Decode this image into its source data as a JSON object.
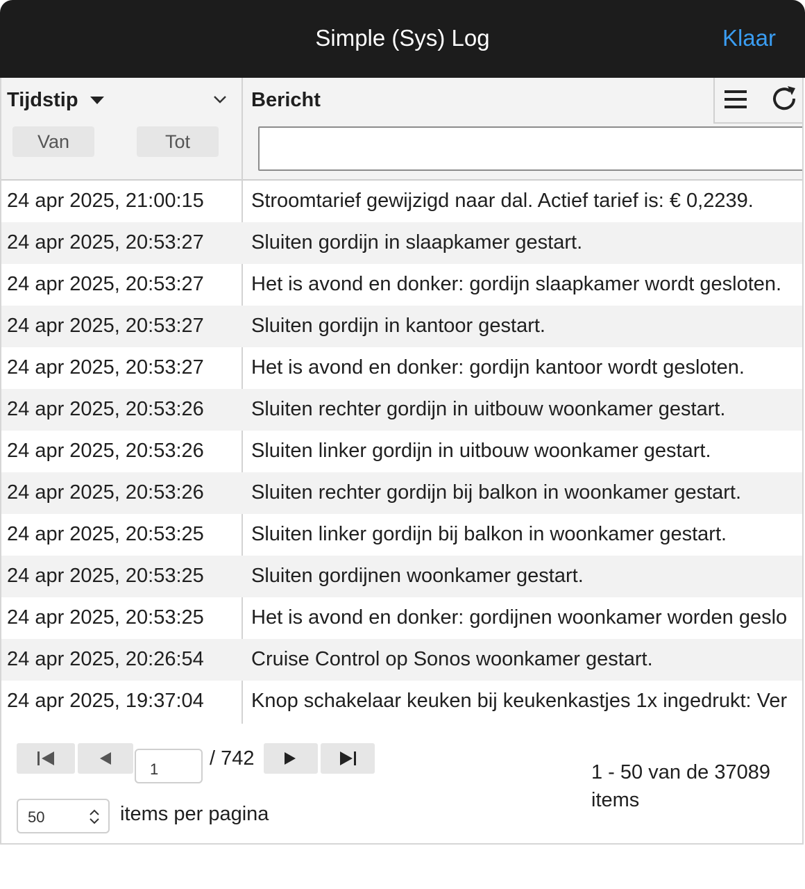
{
  "dialog": {
    "title": "Simple (Sys) Log",
    "done_label": "Klaar"
  },
  "columns": {
    "time": {
      "label": "Tijdstip",
      "from_label": "Van",
      "to_label": "Tot"
    },
    "message": {
      "label": "Bericht",
      "filter_value": ""
    }
  },
  "icons": {
    "sort": "sort-desc-icon",
    "column_menu": "chevron-down-icon",
    "menu": "hamburger-menu-icon",
    "refresh": "refresh-icon"
  },
  "rows": [
    {
      "time": "24 apr 2025, 21:00:15",
      "message": "Stroomtarief gewijzigd naar dal. Actief tarief is: € 0,2239."
    },
    {
      "time": "24 apr 2025, 20:53:27",
      "message": "Sluiten gordijn in slaapkamer gestart."
    },
    {
      "time": "24 apr 2025, 20:53:27",
      "message": "Het is avond en donker: gordijn slaapkamer wordt gesloten."
    },
    {
      "time": "24 apr 2025, 20:53:27",
      "message": "Sluiten gordijn in kantoor gestart."
    },
    {
      "time": "24 apr 2025, 20:53:27",
      "message": "Het is avond en donker: gordijn kantoor wordt gesloten."
    },
    {
      "time": "24 apr 2025, 20:53:26",
      "message": "Sluiten rechter gordijn in uitbouw woonkamer gestart."
    },
    {
      "time": "24 apr 2025, 20:53:26",
      "message": "Sluiten linker gordijn in uitbouw woonkamer gestart."
    },
    {
      "time": "24 apr 2025, 20:53:26",
      "message": "Sluiten rechter gordijn bij balkon in woonkamer gestart."
    },
    {
      "time": "24 apr 2025, 20:53:25",
      "message": "Sluiten linker gordijn bij balkon in woonkamer gestart."
    },
    {
      "time": "24 apr 2025, 20:53:25",
      "message": "Sluiten gordijnen woonkamer gestart."
    },
    {
      "time": "24 apr 2025, 20:53:25",
      "message": "Het is avond en donker: gordijnen woonkamer worden geslo"
    },
    {
      "time": "24 apr 2025, 20:26:54",
      "message": "Cruise Control op Sonos woonkamer gestart."
    },
    {
      "time": "24 apr 2025, 19:37:04",
      "message": "Knop schakelaar keuken bij keukenkastjes 1x ingedrukt: Ver"
    }
  ],
  "pager": {
    "current_page": "1",
    "total_pages": "/ 742",
    "page_size": "50",
    "per_page_label": "items per pagina",
    "summary": "1 - 50 van de 37089 items"
  },
  "colors": {
    "topbar": "#1c1c1c",
    "accent": "#3a9df2",
    "row_alt": "#f2f2f2",
    "header_bg": "#f3f3f3"
  }
}
